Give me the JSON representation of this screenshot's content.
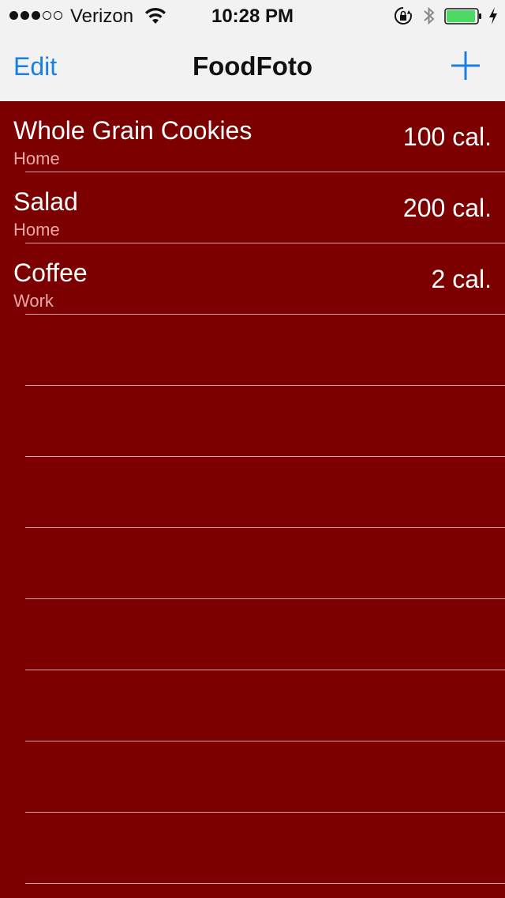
{
  "status_bar": {
    "carrier": "Verizon",
    "time": "10:28 PM",
    "signal_bars_filled": 3,
    "signal_bars_total": 5,
    "battery_fill": 0.95,
    "battery_color": "#4cd964"
  },
  "nav": {
    "edit_label": "Edit",
    "title": "FoodFoto",
    "add_icon": "plus-icon",
    "accent_color": "#1a7fe0"
  },
  "table": {
    "background_color": "#7d0000",
    "rows": [
      {
        "title": "Whole Grain Cookies",
        "subtitle": "Home",
        "detail": "100 cal."
      },
      {
        "title": "Salad",
        "subtitle": "Home",
        "detail": "200 cal."
      },
      {
        "title": "Coffee",
        "subtitle": "Work",
        "detail": "2 cal."
      }
    ]
  }
}
